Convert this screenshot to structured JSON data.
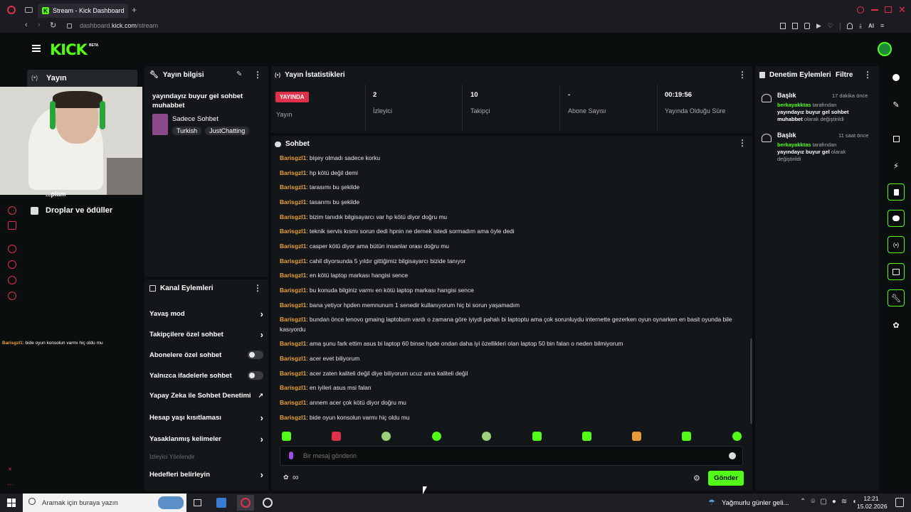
{
  "browser": {
    "tab_title": "Stream - Kick Dashboard",
    "url_prefix": "dashboard.",
    "url_domain": "kick.com",
    "url_path": "/stream",
    "new_tab": "+"
  },
  "header": {
    "logo": "KICK",
    "logo_badge": "BETA"
  },
  "left_nav": {
    "active_item": "Yayın",
    "items": [
      {
        "label": "Droplar ve ödüller",
        "icon": "gift-icon"
      }
    ],
    "partial_label": "...plam",
    "overlay_chat": {
      "user": "Barisgzl1",
      "text": ": bide oyun konsolun varmı hiç oldu mu"
    }
  },
  "stream_info": {
    "title": "Yayın bilgisi",
    "stream_title": "yayındayız buyur gel sohbet muhabbet",
    "category": "Sadece Sohbet",
    "tags": [
      "Turkish",
      "JustChatting"
    ]
  },
  "channel_actions": {
    "title": "Kanal Eylemleri",
    "rows": [
      {
        "label": "Yavaş mod",
        "control": "chevron"
      },
      {
        "label": "Takipçilere özel sohbet",
        "control": "chevron"
      },
      {
        "label": "Abonelere özel sohbet",
        "control": "toggle"
      },
      {
        "label": "Yalnızca ifadelerle sohbet",
        "control": "toggle"
      },
      {
        "label": "Yapay Zeka ile Sohbet Denetimi",
        "control": "external"
      },
      {
        "label": "Hesap yaşı kısıtlaması",
        "control": "chevron"
      },
      {
        "label": "Yasaklanmış kelimeler",
        "control": "chevron"
      }
    ],
    "section_label": "İzleyici Yönlendir",
    "last_row": "Hedefleri belirleyin"
  },
  "stats": {
    "title": "Yayın İstatistikleri",
    "live_badge": "YAYINDA",
    "items": [
      {
        "value": "",
        "label": "Yayın"
      },
      {
        "value": "2",
        "label": "İzleyici"
      },
      {
        "value": "10",
        "label": "Takipçi"
      },
      {
        "value": "-",
        "label": "Abone Sayısı"
      },
      {
        "value": "00:19:56",
        "label": "Yayında Olduğu Süre"
      }
    ]
  },
  "chat": {
    "title": "Sohbet",
    "messages": [
      {
        "user": "Barisgzl1",
        "text": ": bişey olmadı sadece korku"
      },
      {
        "user": "Barisgzl1",
        "text": ": hp kötü değil demi"
      },
      {
        "user": "Barisgzl1",
        "text": ": tarasımı bu şekilde"
      },
      {
        "user": "Barisgzl1",
        "text": ": tasarımı bu şekilde"
      },
      {
        "user": "Barisgzl1",
        "text": ": bizim tanıdık bilgisayarcı var hp kötü diyor doğru mu"
      },
      {
        "user": "Barisgzl1",
        "text": ": teknik servis kısmı sorun dedi hpnin ne demek istedi sormadım ama öyle dedi"
      },
      {
        "user": "Barisgzl1",
        "text": ": casper kötü diyor ama bütün insanlar orası doğru mu"
      },
      {
        "user": "Barisgzl1",
        "text": ": cahil diyorsunda 5 yıldır gittiğimiz bilgisayarcı bizide tanıyor"
      },
      {
        "user": "Barisgzl1",
        "text": ": en kötü laptop markası hangisi sence"
      },
      {
        "user": "Barisgzl1",
        "text": ": bu konuda bilginiz varmı en kötü laptop markası hangisi sence"
      },
      {
        "user": "Barisgzl1",
        "text": ": bana yetiyor hpden memnunum 1 senedir kullanıyorum hiç bi sorun yaşamadım"
      },
      {
        "user": "Barisgzl1",
        "text": ": bundan önce lenovo gmaing laptobum vardı o zamana göre iyiydi pahalı bi laptoptu ama çok sorunluydu internette gezerken oyun oynarken en basit oyunda bile kasıyordu"
      },
      {
        "user": "Barisgzl1",
        "text": ": ama şunu fark ettim asus bi laptop 60 binse hpde ondan daha iyi özellikleri olan laptop 50 bin falan o neden bilmiyorum"
      },
      {
        "user": "Barisgzl1",
        "text": ": acer evet biliyorum"
      },
      {
        "user": "Barisgzl1",
        "text": ": acer zaten kaliteli değil diye biliyorum ucuz ama kaliteli değil"
      },
      {
        "user": "Barisgzl1",
        "text": ": en iyileri asus msi falan"
      },
      {
        "user": "Barisgzl1",
        "text": ": annem acer çok kötü diyor doğru mu"
      },
      {
        "user": "Barisgzl1",
        "text": ": bide oyun konsolun varmı hiç oldu mu"
      }
    ],
    "input_placeholder": "Bir mesaj gönderin",
    "send_label": "Gönder",
    "infinity": "∞"
  },
  "mod_actions": {
    "title": "Denetim Eylemleri",
    "filter": "Filtre",
    "entries": [
      {
        "heading": "Başlık",
        "time": "17 dakika önce",
        "user": "berkayakktas",
        "mid": " tarafından ",
        "title": "yayındayız buyur gel sohbet muhabbet",
        "tail": " olarak değiştirildi"
      },
      {
        "heading": "Başlık",
        "time": "11 saat önce",
        "user": "berkayakktas",
        "mid": " tarafından ",
        "title": "yayındayız buyur gel",
        "tail": " olarak değiştirildi"
      }
    ]
  },
  "taskbar": {
    "search_placeholder": "Aramak için buraya yazın",
    "weather": "Yağmurlu günler geli...",
    "time": "12:21",
    "date": "15.02.2026"
  },
  "colors": {
    "accent": "#53fc18",
    "live_red": "#e0314b",
    "username": "#e9a03b"
  }
}
